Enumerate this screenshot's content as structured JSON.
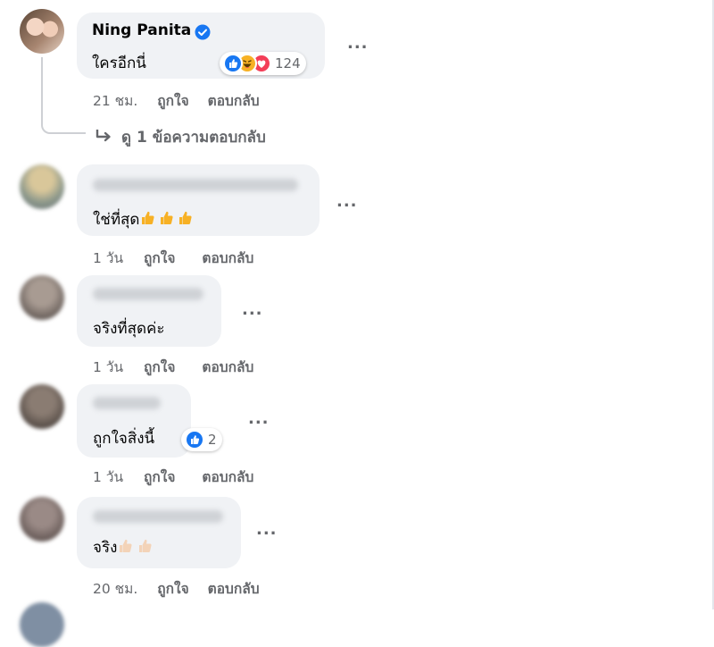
{
  "comments": [
    {
      "author": "Ning Panita",
      "verified": true,
      "text": "ใครอีกนี่",
      "time": "21 ชม.",
      "like_label": "ถูกใจ",
      "reply_label": "ตอบกลับ",
      "reaction_count": "124",
      "reactions": [
        "like-icon",
        "haha-icon",
        "love-icon"
      ],
      "view_replies": "ดู 1 ข้อความตอบกลับ"
    },
    {
      "author": "",
      "text": "ใช่ที่สุด",
      "emoji": [
        "thumbs-up-icon",
        "thumbs-up-icon",
        "thumbs-up-icon"
      ],
      "time": "1 วัน",
      "like_label": "ถูกใจ",
      "reply_label": "ตอบกลับ"
    },
    {
      "author": "",
      "text": "จริงที่สุดค่ะ",
      "time": "1 วัน",
      "like_label": "ถูกใจ",
      "reply_label": "ตอบกลับ"
    },
    {
      "author": "",
      "text": "ถูกใจสิ่งนี้",
      "time": "1 วัน",
      "like_label": "ถูกใจ",
      "reply_label": "ตอบกลับ",
      "reaction_count": "2",
      "reactions": [
        "like-icon"
      ]
    },
    {
      "author": "",
      "text": "จริง",
      "emoji": [
        "thumbs-up-light-icon",
        "thumbs-up-light-icon"
      ],
      "time": "20 ชม.",
      "like_label": "ถูกใจ",
      "reply_label": "ตอบกลับ"
    }
  ],
  "more_label": "...",
  "colors": {
    "bubble": "#f0f2f5",
    "meta": "#65676b",
    "verified": "#1877f2",
    "like": "#1877f2",
    "love": "#f33e58",
    "haha": "#f7b125"
  }
}
